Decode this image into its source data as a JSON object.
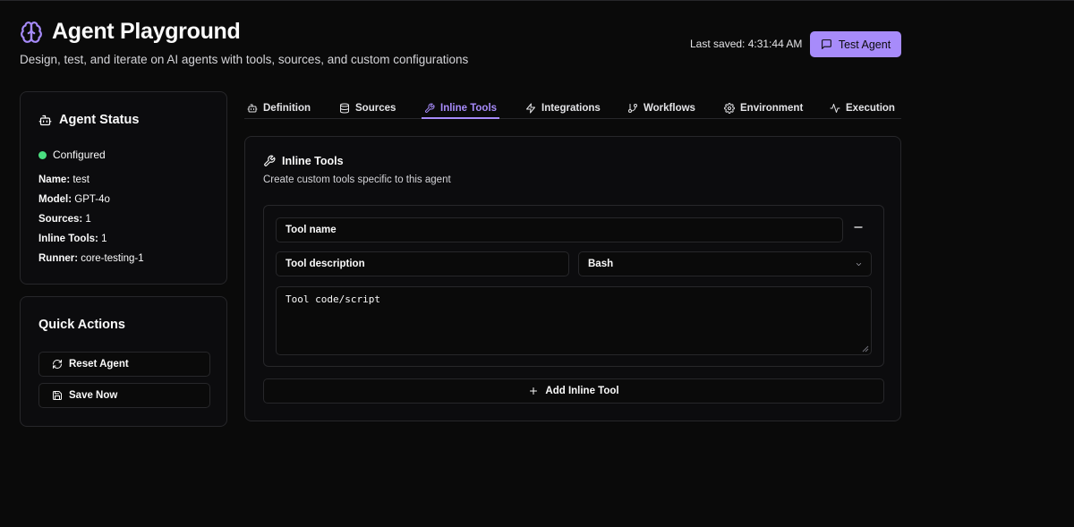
{
  "header": {
    "title": "Agent Playground",
    "subtitle": "Design, test, and iterate on AI agents with tools, sources, and custom configurations",
    "last_saved": "Last saved: 4:31:44 AM",
    "test_button": "Test Agent",
    "brand_color": "#a78bfa"
  },
  "status": {
    "title": "Agent Status",
    "state": "Configured",
    "state_color": "#4ade80",
    "items": [
      {
        "label": "Name:",
        "value": "test"
      },
      {
        "label": "Model:",
        "value": "GPT-4o"
      },
      {
        "label": "Sources:",
        "value": "1"
      },
      {
        "label": "Inline Tools:",
        "value": "1"
      },
      {
        "label": "Runner:",
        "value": "core-testing-1"
      }
    ]
  },
  "quick_actions": {
    "title": "Quick Actions",
    "reset": "Reset Agent",
    "save": "Save Now"
  },
  "tabs": [
    {
      "label": "Definition",
      "icon": "bot-icon"
    },
    {
      "label": "Sources",
      "icon": "database-icon"
    },
    {
      "label": "Inline Tools",
      "icon": "wrench-icon",
      "active": true
    },
    {
      "label": "Integrations",
      "icon": "zap-icon"
    },
    {
      "label": "Workflows",
      "icon": "git-branch-icon"
    },
    {
      "label": "Environment",
      "icon": "gear-icon"
    },
    {
      "label": "Execution",
      "icon": "activity-icon"
    }
  ],
  "inline_tools": {
    "title": "Inline Tools",
    "description": "Create custom tools specific to this agent",
    "tool": {
      "name_placeholder": "Tool name",
      "description_placeholder": "Tool description",
      "language": "Bash",
      "code_placeholder": "Tool code/script"
    },
    "add_button": "Add Inline Tool"
  }
}
